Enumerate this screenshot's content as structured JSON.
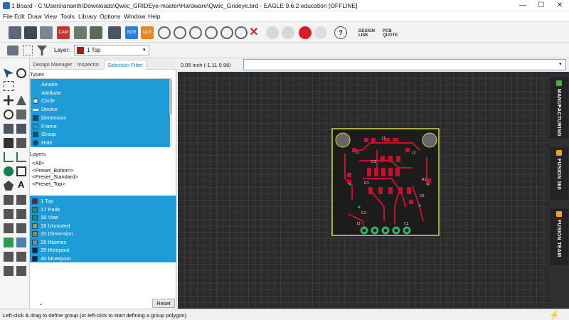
{
  "window": {
    "title": "1 Board - C:\\Users\\ananth\\Downloads\\Qwiic_GRIDEye-master\\Hardware\\Qwiic_Grideye.brd - EAGLE 9.6.2 education [OFFLINE]",
    "min": "—",
    "max": "☐",
    "close": "✕"
  },
  "menu": [
    "File",
    "Edit",
    "Draw",
    "View",
    "Tools",
    "Library",
    "Options",
    "Window",
    "Help"
  ],
  "toolbar": {
    "scr_label": "SCR",
    "ulp_label": "ULP",
    "design_link_label": "DESIGN LINK",
    "pcb_quote_label": "PCB QUOTE",
    "help_label": "?"
  },
  "layer_select": {
    "label": "Layer:",
    "value": "1 Top",
    "color": "#b0141c"
  },
  "tabs": [
    "Design Manager",
    "Inspector",
    "Selection Filter"
  ],
  "types": {
    "heading": "Types",
    "items": [
      "Airwire",
      "Attribute",
      "Circle",
      "Device",
      "Dimension",
      "Frame",
      "Group",
      "Hole"
    ]
  },
  "layers": {
    "heading": "Layers",
    "presets": [
      "<All>",
      "<Preset_Bottom>",
      "<Preset_Standard>",
      "<Preset_Top>"
    ],
    "items": [
      {
        "label": "1 Top",
        "color": "#8b1a1a"
      },
      {
        "label": "17 Pads",
        "color": "#2e8b57"
      },
      {
        "label": "18 Vias",
        "color": "#2e8b57"
      },
      {
        "label": "19 Unrouted",
        "color": "#a0a040"
      },
      {
        "label": "20 Dimension",
        "color": "#8a8a40"
      },
      {
        "label": "25 tNames",
        "color": "#888888"
      },
      {
        "label": "39 tKeepout",
        "color": "#102030"
      },
      {
        "label": "40 bKeepout",
        "color": "#102030"
      }
    ]
  },
  "reset_label": "Reset",
  "coordinate": "0.05 inch (-1.11 0.96)",
  "command_value": "",
  "right_tabs": [
    "MANUFACTURING",
    "FUSION 360",
    "FUSION TEAM"
  ],
  "board_labels": {
    "j1": "J1",
    "j2": "J2",
    "j3": "J3",
    "j7": "J7",
    "u1": "U1",
    "c1": "C1",
    "c2": "C2",
    "c3": "C3",
    "c6": "C6",
    "r2": "R2"
  },
  "status": "Left-click & drag to define group (or left-click to start defining a group polygon)",
  "colors": {
    "selection": "#1f9cd8",
    "canvas": "#2b2b2b",
    "board_outline": "#d7d44c",
    "copper": "#c8102e",
    "pads": "#2db56a"
  }
}
